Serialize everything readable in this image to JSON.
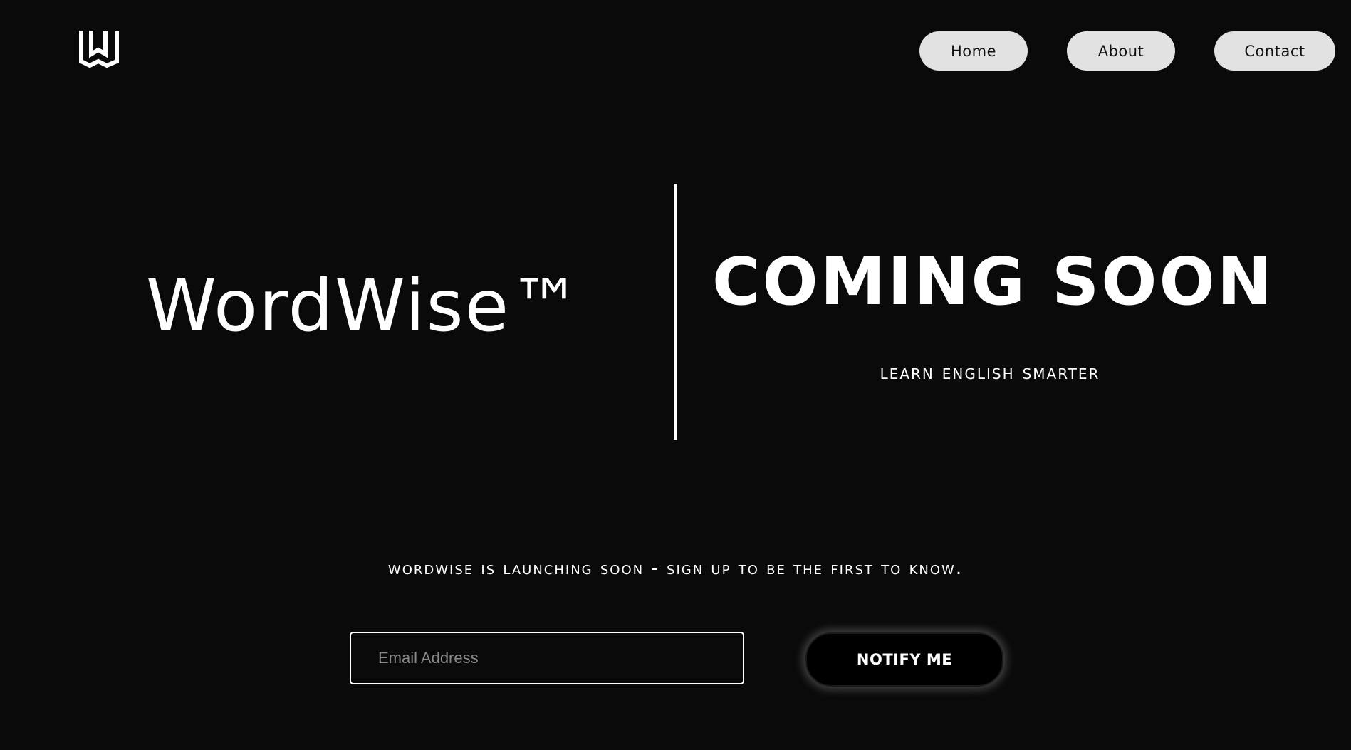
{
  "header": {
    "logo_icon": "wordwise-logo-icon",
    "nav": {
      "home_label": "Home",
      "about_label": "About",
      "contact_label": "Contact"
    }
  },
  "hero": {
    "brand": "WordWise™",
    "headline": "COMING SOON",
    "tagline": "Learn English smarter"
  },
  "signup": {
    "message": "WordWise is launching soon - sign up to be the first to know.",
    "email_placeholder": "Email Address",
    "email_value": "",
    "button_label": "NOTIFY ME"
  },
  "colors": {
    "background": "#0a0a0b",
    "text": "#ffffff",
    "nav_button_bg": "#e2e2e2",
    "nav_button_text": "#111111"
  }
}
